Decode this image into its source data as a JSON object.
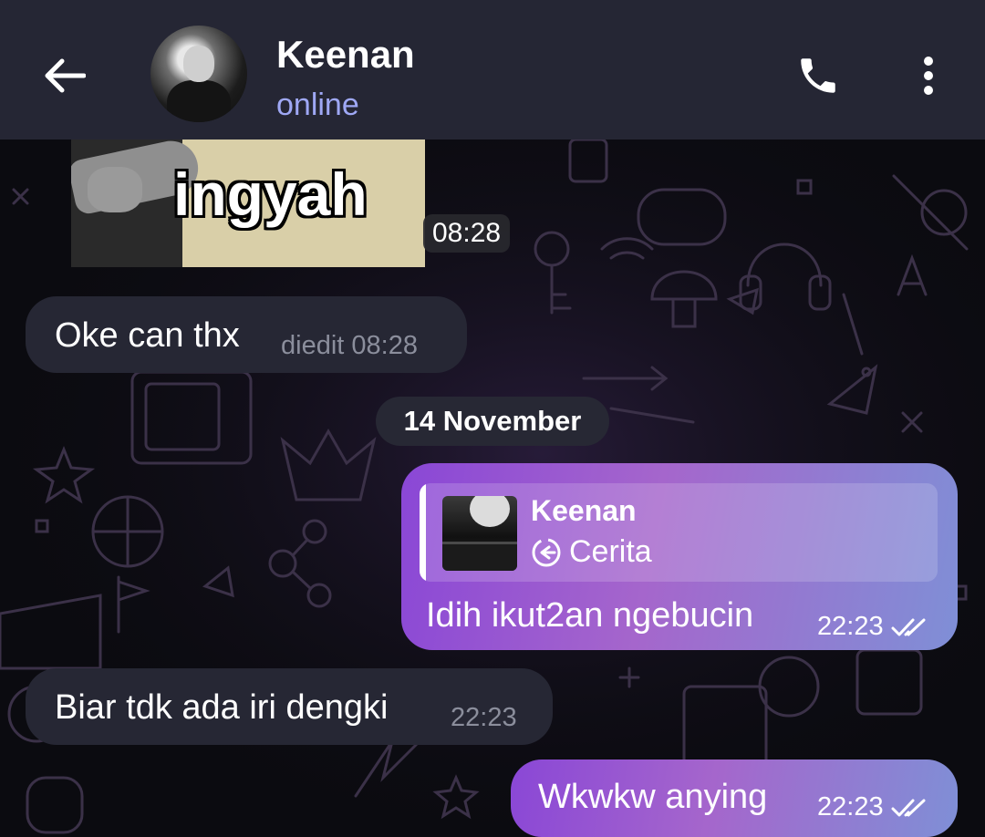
{
  "header": {
    "contact_name": "Keenan",
    "status": "online",
    "back_icon": "arrow-left-icon",
    "call_icon": "phone-icon",
    "menu_icon": "more-vertical-icon"
  },
  "messages": {
    "sticker": {
      "text": "ingyah",
      "time": "08:28"
    },
    "msg1": {
      "text": "Oke can thx",
      "meta": "diedit 08:28"
    },
    "date_separator": "14 November",
    "msg2": {
      "reply_author": "Keenan",
      "reply_type": "Cerita",
      "text": "Idih ikut2an ngebucin",
      "time": "22:23",
      "status": "read"
    },
    "msg3": {
      "text": "Biar tdk ada iri dengki",
      "time": "22:23"
    },
    "msg4": {
      "text": "Wkwkw anying",
      "time": "22:23",
      "status": "read"
    }
  },
  "colors": {
    "header_bg": "#252634",
    "incoming_bubble": "#262734",
    "outgoing_gradient_start": "#8a47d6",
    "outgoing_gradient_end": "#7f8fd6",
    "status_online": "#9fa8f5"
  }
}
